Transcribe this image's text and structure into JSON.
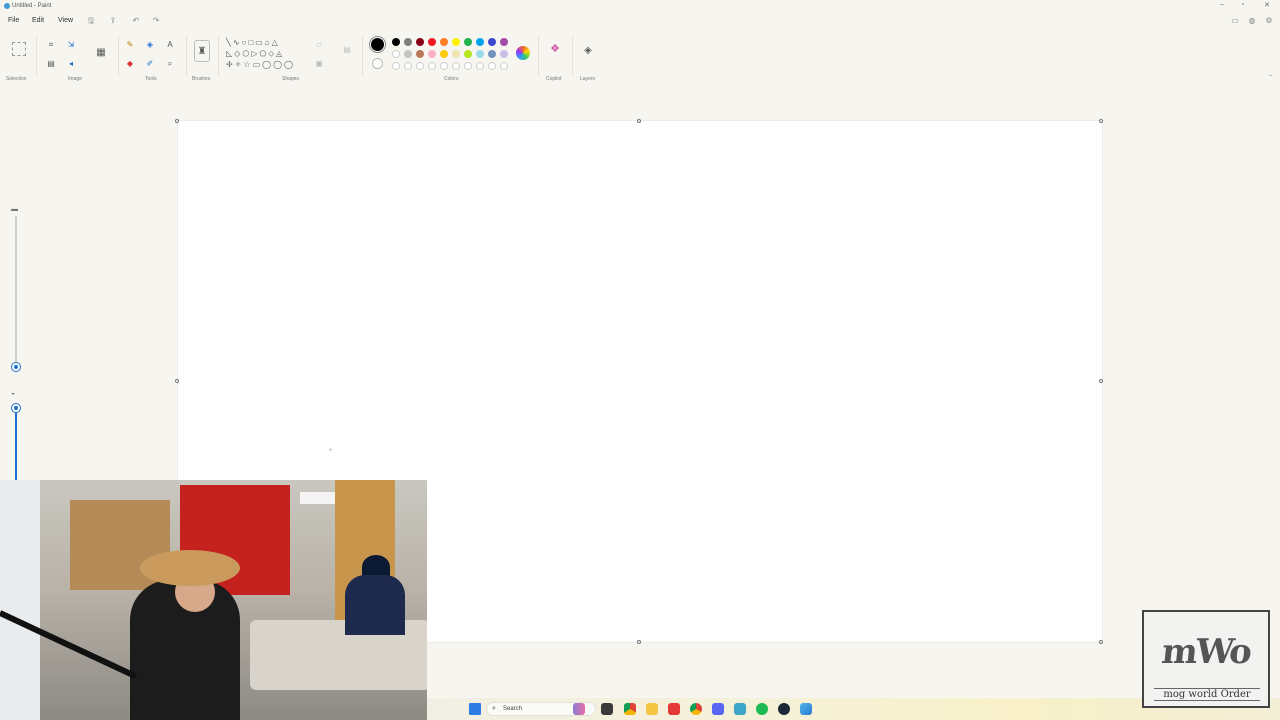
{
  "window": {
    "title": "Untitled - Paint",
    "controls": [
      "minimize",
      "restore",
      "close"
    ]
  },
  "menu": {
    "file": "File",
    "edit": "Edit",
    "view": "View"
  },
  "quick_access": [
    "save-icon",
    "share-icon",
    "undo-icon",
    "redo-icon"
  ],
  "ribbon": {
    "groups": {
      "selection": "Selection",
      "image": "Image",
      "tools": "Tools",
      "brushes": "Brushes",
      "shapes": "Shapes",
      "colors": "Colors",
      "copilot": "Copilot",
      "layers": "Layers"
    }
  },
  "colors": {
    "current_primary": "#000000",
    "current_secondary": "#ffffff",
    "palette_row1": [
      "#000000",
      "#7f7f7f",
      "#880015",
      "#ed1c24",
      "#ff7f27",
      "#fff200",
      "#22b14c",
      "#00a2e8",
      "#3f48cc",
      "#a349a4"
    ],
    "palette_row2": [
      "#ffffff",
      "#c3c3c3",
      "#b97a57",
      "#ffaec9",
      "#ffc90e",
      "#efe4b0",
      "#b5e61d",
      "#99d9ea",
      "#7092be",
      "#c8bfe7"
    ],
    "palette_row3_count": 10,
    "accent": "#1e6fd1"
  },
  "canvas": {
    "background": "#ffffff"
  },
  "left_sliders": {
    "brush_size_level": 0.0,
    "opacity_level": 1.0
  },
  "taskbar": {
    "search_placeholder": "Search",
    "apps": [
      "windows-start-icon",
      "search-box",
      "copilot-icon",
      "file-explorer-icon",
      "chrome-icon",
      "folder-icon",
      "app-red-icon",
      "chrome-icon",
      "discord-icon",
      "notepad-icon",
      "spotify-icon",
      "steam-icon",
      "paint-icon"
    ]
  },
  "overlay": {
    "logo_text": "mWo",
    "logo_tagline": "mog world Order"
  }
}
